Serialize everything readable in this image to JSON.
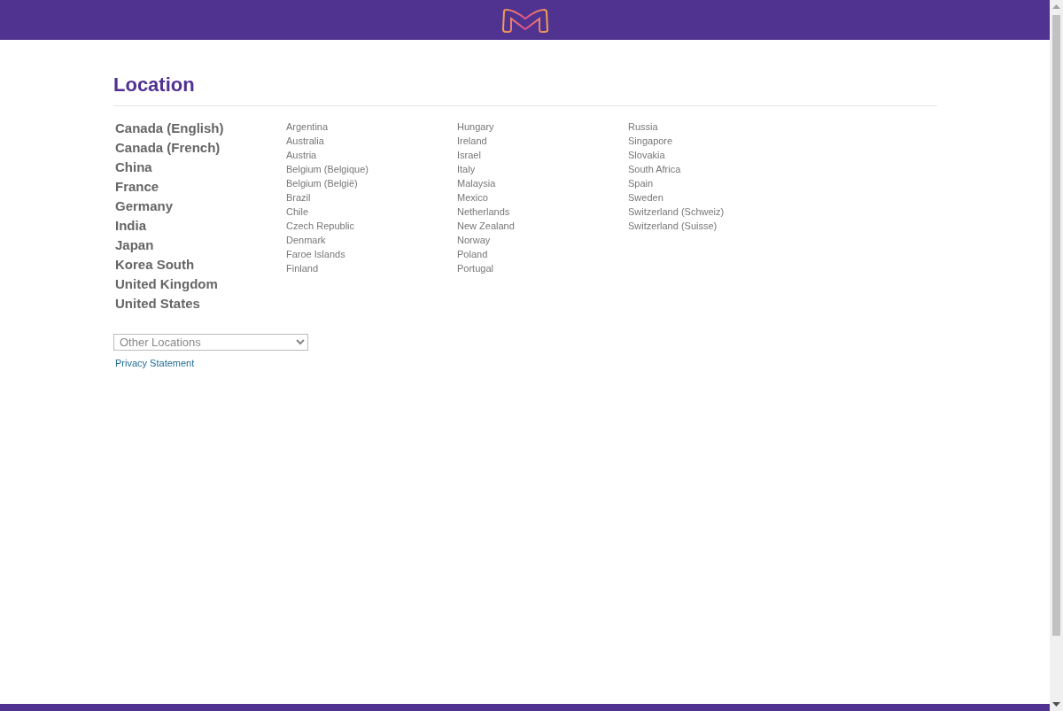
{
  "heading": "Location",
  "major_locations": [
    "Canada (English)",
    "Canada (French)",
    "China",
    "France",
    "Germany",
    "India",
    "Japan",
    "Korea South",
    "United Kingdom",
    "United States"
  ],
  "location_columns": [
    [
      "Argentina",
      "Australia",
      "Austria",
      "Belgium (Belgique)",
      "Belgium (België)",
      "Brazil",
      "Chile",
      "Czech Republic",
      "Denmark",
      "Faroe Islands",
      "Finland"
    ],
    [
      "Hungary",
      "Ireland",
      "Israel",
      "Italy",
      "Malaysia",
      "Mexico",
      "Netherlands",
      "New Zealand",
      "Norway",
      "Poland",
      "Portugal"
    ],
    [
      "Russia",
      "Singapore",
      "Slovakia",
      "South Africa",
      "Spain",
      "Sweden",
      "Switzerland (Schweiz)",
      "Switzerland (Suisse)"
    ]
  ],
  "other_locations": {
    "value": "Other Locations"
  },
  "privacy_link": "Privacy Statement"
}
